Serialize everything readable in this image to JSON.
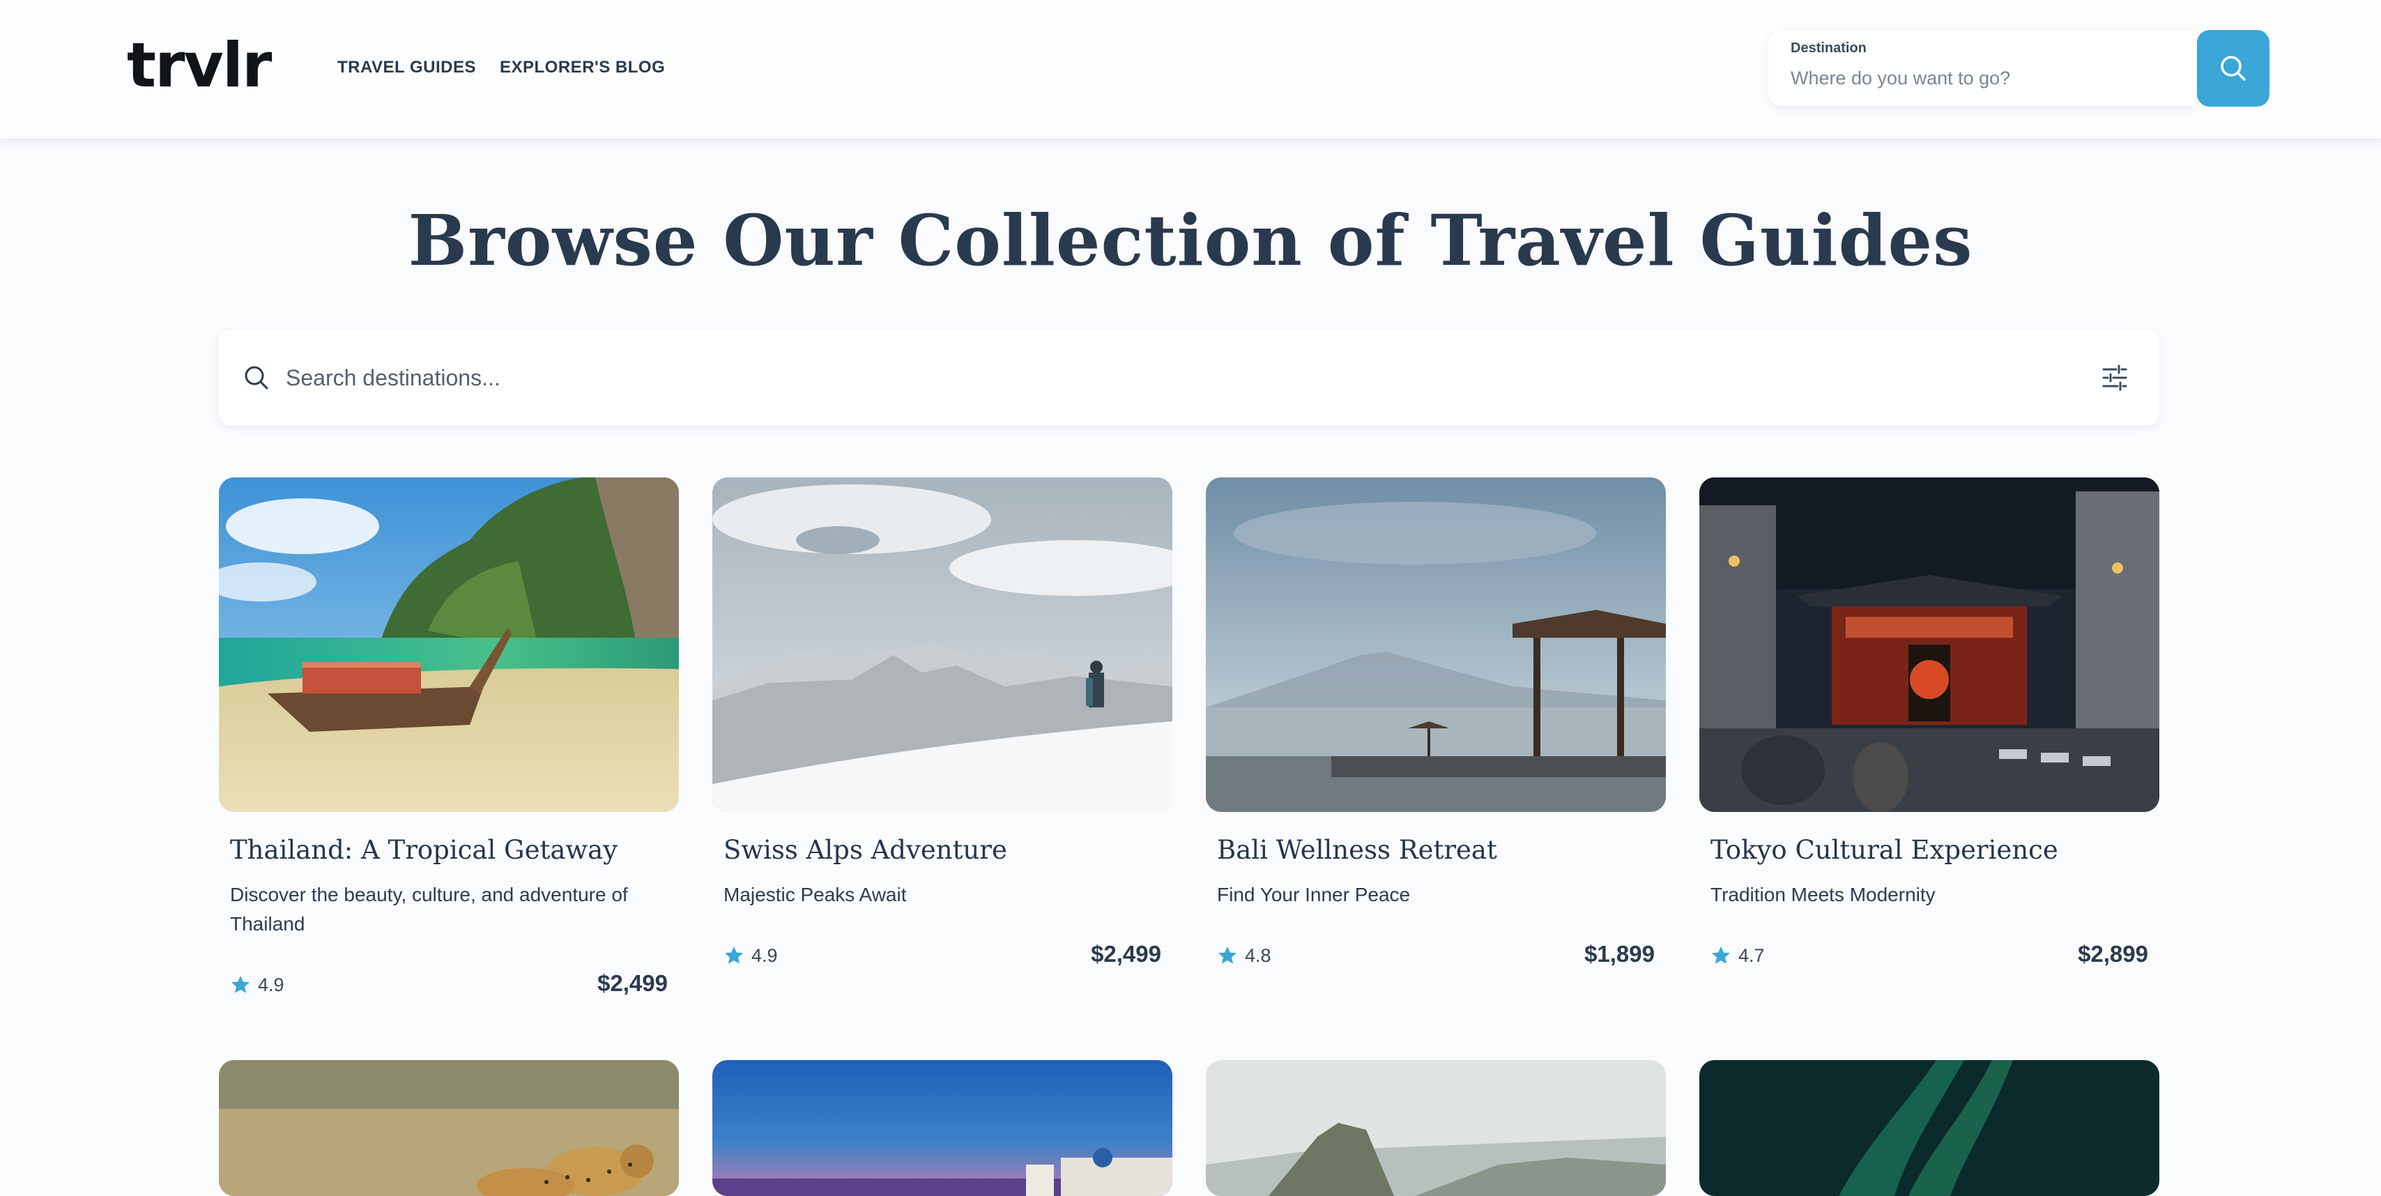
{
  "header": {
    "logo": "trvlr",
    "nav": [
      {
        "label": "TRAVEL GUIDES"
      },
      {
        "label": "EXPLORER'S BLOG"
      }
    ],
    "destination_label": "Destination",
    "destination_placeholder": "Where do you want to go?",
    "search_button_icon": "search-icon"
  },
  "main": {
    "title": "Browse Our Collection of Travel Guides",
    "search_placeholder": "Search destinations...",
    "filter_icon": "sliders-icon"
  },
  "cards": [
    {
      "title": "Thailand: A Tropical Getaway",
      "description": "Discover the beauty, culture, and adventure of Thailand",
      "rating": "4.9",
      "price": "$2,499"
    },
    {
      "title": "Swiss Alps Adventure",
      "description": "Majestic Peaks Await",
      "rating": "4.9",
      "price": "$2,499"
    },
    {
      "title": "Bali Wellness Retreat",
      "description": "Find Your Inner Peace",
      "rating": "4.8",
      "price": "$1,899"
    },
    {
      "title": "Tokyo Cultural Experience",
      "description": "Tradition Meets Modernity",
      "rating": "4.7",
      "price": "$2,899"
    }
  ],
  "colors": {
    "accent": "#3ba7d6",
    "text": "#2b3a4d",
    "background": "#fafbfd"
  }
}
